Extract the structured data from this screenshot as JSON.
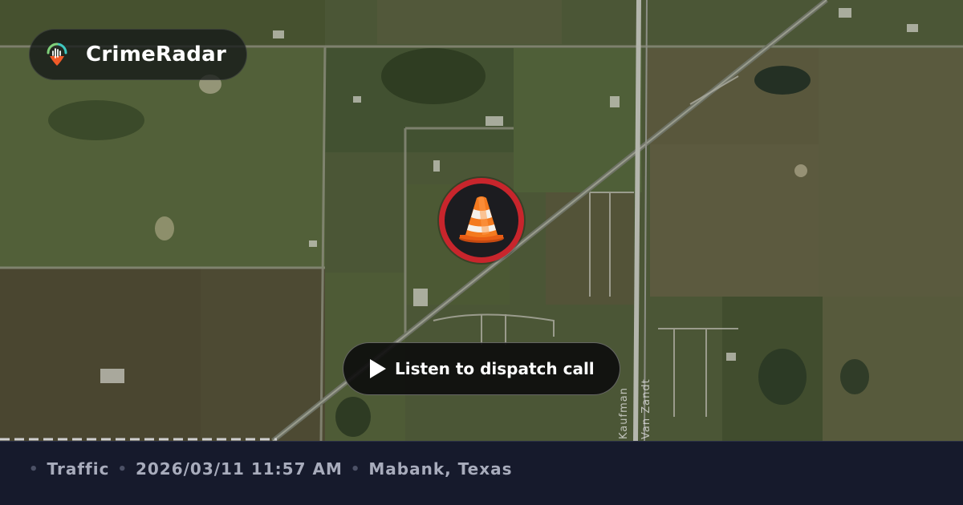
{
  "app": {
    "name": "CrimeRadar",
    "logo_icon": "crimeradar-pin-logo-icon",
    "accent_teal": "#3ec8c0",
    "accent_orange": "#f05a28"
  },
  "map": {
    "road_labels": [
      "Kaufman",
      "Van Zandt"
    ]
  },
  "incident": {
    "icon": "traffic-cone-icon",
    "marker_color": "#c8252c"
  },
  "action": {
    "listen_label": "Listen to dispatch call",
    "icon": "play-icon"
  },
  "footer": {
    "separator": "•",
    "category": "Traffic",
    "datetime": "2026/03/11 11:57 AM",
    "location": "Mabank, Texas"
  }
}
